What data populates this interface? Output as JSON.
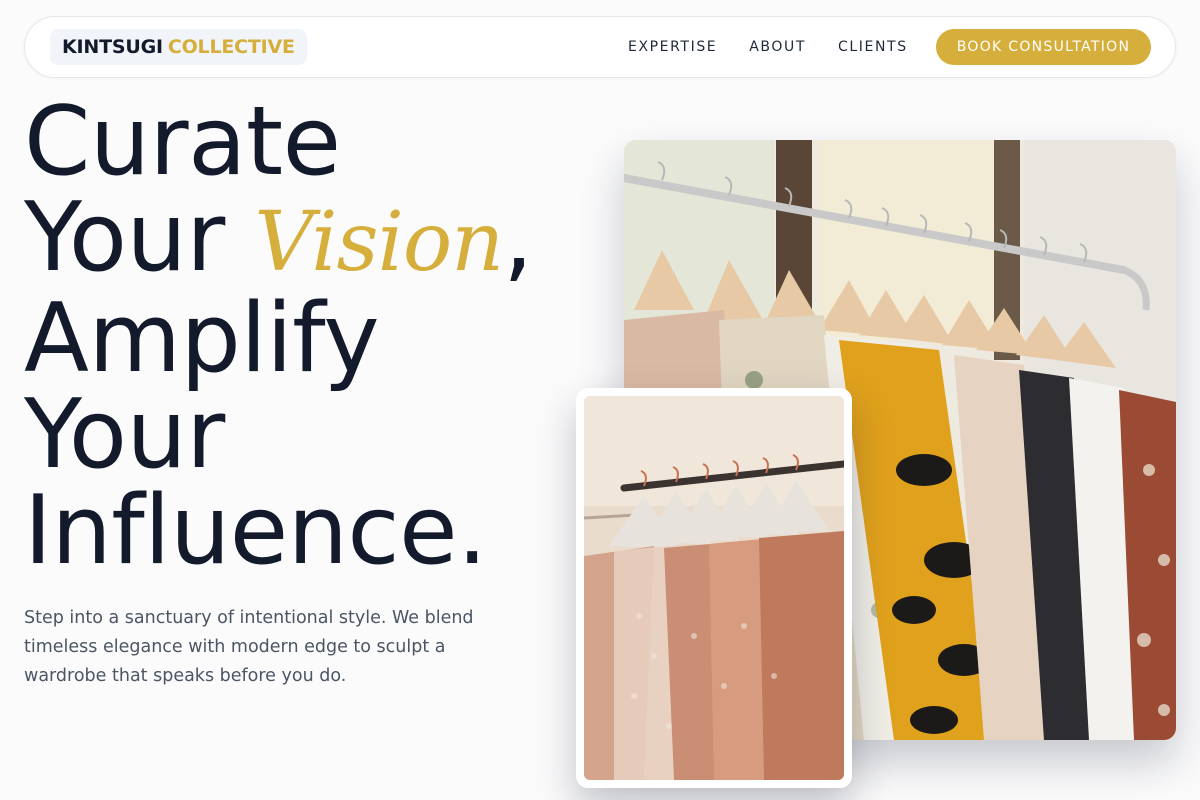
{
  "brand": {
    "name_primary": "KINTSUGI",
    "name_accent": "COLLECTIVE"
  },
  "nav": {
    "links": [
      "EXPERTISE",
      "ABOUT",
      "CLIENTS"
    ],
    "cta_label": "BOOK CONSULTATION"
  },
  "hero": {
    "line1": "Curate",
    "line2_prefix": "Your ",
    "line2_accent": "Vision",
    "line2_suffix": ",",
    "line3": "Amplify",
    "line4": "Your",
    "line5": "Influence.",
    "subcopy": "Step into a sanctuary of intentional style. We blend timeless elegance with modern edge to sculpt a wardrobe that speaks before you do."
  },
  "images": {
    "main": "clothing-rack-photo",
    "secondary": "blush-garments-rack-photo"
  },
  "colors": {
    "accent": "#d6ae3c",
    "ink": "#121a2c",
    "muted": "#4b5563",
    "background": "#fbfbfc"
  }
}
